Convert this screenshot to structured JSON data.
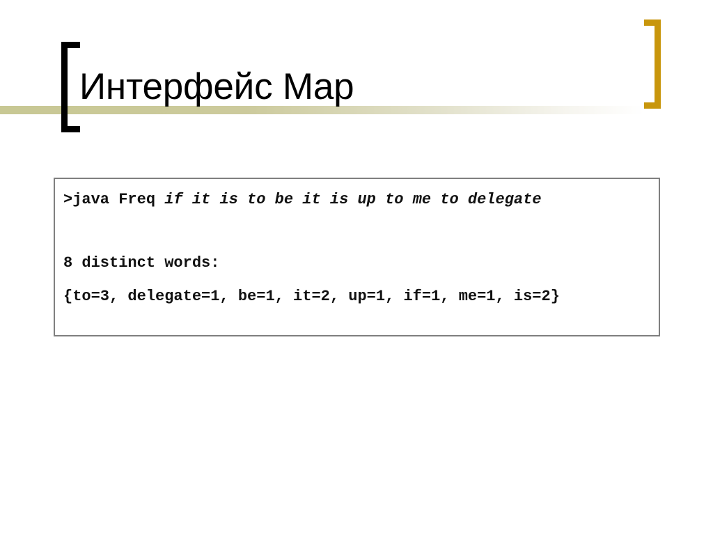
{
  "slide": {
    "title": "Интерфейс Map",
    "decor": {
      "left_bracket": "left-bracket",
      "right_bracket": "right-bracket",
      "band": "title-underline-band",
      "left_bracket_color": "#000000",
      "right_bracket_color": "#c8960c",
      "band_color": "#c8c894",
      "background_color": "#ffffff"
    },
    "console": {
      "border_color": "#7f7f7f",
      "background_color": "#ffffff",
      "lines": [
        {
          "id": "command-line",
          "command": ">java Freq ",
          "arguments": "if it is to be it is up to me to delegate"
        },
        {
          "id": "blank-line",
          "text": ""
        },
        {
          "id": "distinct-count-line",
          "text": "8 distinct words:"
        },
        {
          "id": "map-output-line",
          "text": "{to=3, delegate=1, be=1, it=2, up=1, if=1, me=1, is=2}"
        }
      ]
    }
  }
}
